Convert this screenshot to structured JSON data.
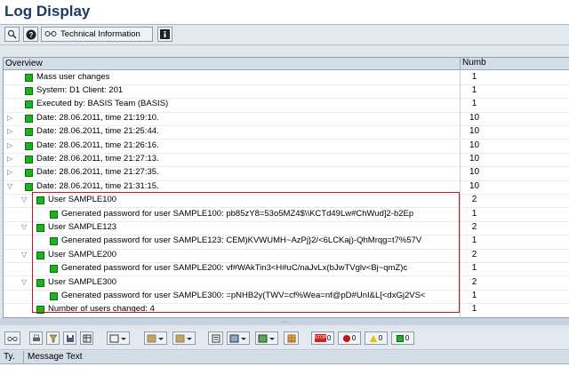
{
  "window": {
    "title": "Log Display"
  },
  "toolbar": {
    "technical_info_label": "Technical Information"
  },
  "tree": {
    "header_overview": "Overview",
    "header_number": "Numb",
    "rows": [
      {
        "text": "Mass user changes",
        "num": "1",
        "level": 1,
        "expander": ""
      },
      {
        "text": "System:   D1 Client: 201",
        "num": "1",
        "level": 1,
        "expander": ""
      },
      {
        "text": "Executed by: BASIS Team (BASIS)",
        "num": "1",
        "level": 1,
        "expander": ""
      },
      {
        "text": "Date: 28.06.2011, time 21:19:10.",
        "num": "10",
        "level": 1,
        "expander": "closed"
      },
      {
        "text": "Date: 28.06.2011, time 21:25:44.",
        "num": "10",
        "level": 1,
        "expander": "closed"
      },
      {
        "text": "Date: 28.06.2011, time 21:26:16.",
        "num": "10",
        "level": 1,
        "expander": "closed"
      },
      {
        "text": "Date: 28.06.2011, time 21:27:13.",
        "num": "10",
        "level": 1,
        "expander": "closed"
      },
      {
        "text": "Date: 28.06.2011, time 21:27:35.",
        "num": "10",
        "level": 1,
        "expander": "closed"
      },
      {
        "text": "Date: 28.06.2011, time 21:31:15.",
        "num": "10",
        "level": 1,
        "expander": "open"
      },
      {
        "text": "User SAMPLE100",
        "num": "2",
        "level": 2,
        "expander": "open"
      },
      {
        "text": "Generated password for user SAMPLE100: pb85zY8=53o5MZ4$\\\\KCTd49Lw#ChWud]2-b2Ep",
        "num": "1",
        "level": 3,
        "expander": ""
      },
      {
        "text": "User SAMPLE123",
        "num": "2",
        "level": 2,
        "expander": "open"
      },
      {
        "text": "Generated password for user SAMPLE123: CEM)KVWUMH~AzPj}2/<6LCKaj)-QhMrqg=t7%57V",
        "num": "1",
        "level": 3,
        "expander": ""
      },
      {
        "text": "User SAMPLE200",
        "num": "2",
        "level": 2,
        "expander": "open"
      },
      {
        "text": "Generated password for user SAMPLE200: vf#WAkTin3<H#uC/naJvLx(bJwTVglv<Bj~qmZ)c",
        "num": "1",
        "level": 3,
        "expander": ""
      },
      {
        "text": "User SAMPLE300",
        "num": "2",
        "level": 2,
        "expander": "open"
      },
      {
        "text": "Generated password for user SAMPLE300: =pNHB2y(TWV=cf%Wea=nf@pD#UnI&L[<dxGj2VS<",
        "num": "1",
        "level": 3,
        "expander": ""
      },
      {
        "text": "Number of users changed: 4",
        "num": "1",
        "level": 2,
        "expander": ""
      }
    ]
  },
  "bottom_toolbar": {
    "stop_count": "0",
    "error_count": "0",
    "warning_count": "0",
    "success_count": "0"
  },
  "message_table": {
    "col_type": "Ty.",
    "col_text": "Message Text"
  },
  "colors": {
    "led_green": "#1fb21f",
    "highlight_box": "#b41e1e",
    "title": "#1b3a65"
  }
}
